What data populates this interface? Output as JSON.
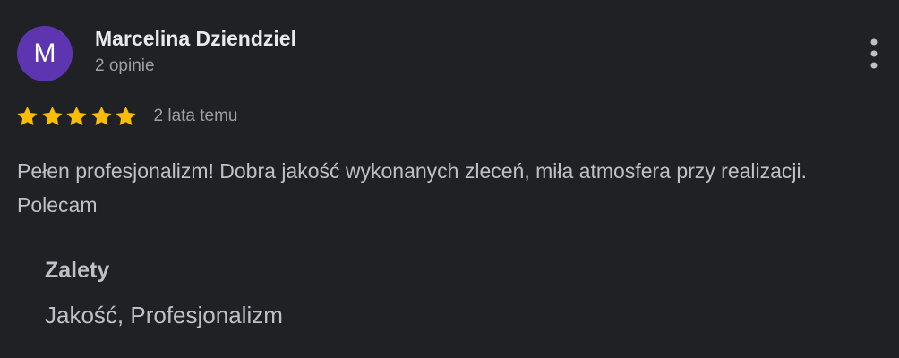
{
  "author": {
    "initial": "M",
    "name": "Marcelina Dziendziel",
    "reviews_count": "2 opinie",
    "avatar_color": "#5e35b1"
  },
  "review": {
    "rating": 5,
    "rating_max": 5,
    "star_color": "#fbbc04",
    "date": "2 lata temu",
    "text": "Pełen profesjonalizm! Dobra jakość wykonanych zleceń, miła atmosfera przy realizacji. Polecam"
  },
  "pros": {
    "heading": "Zalety",
    "values": "Jakość, Profesjonalizm"
  },
  "menu": {
    "icon": "more-vertical-icon"
  }
}
